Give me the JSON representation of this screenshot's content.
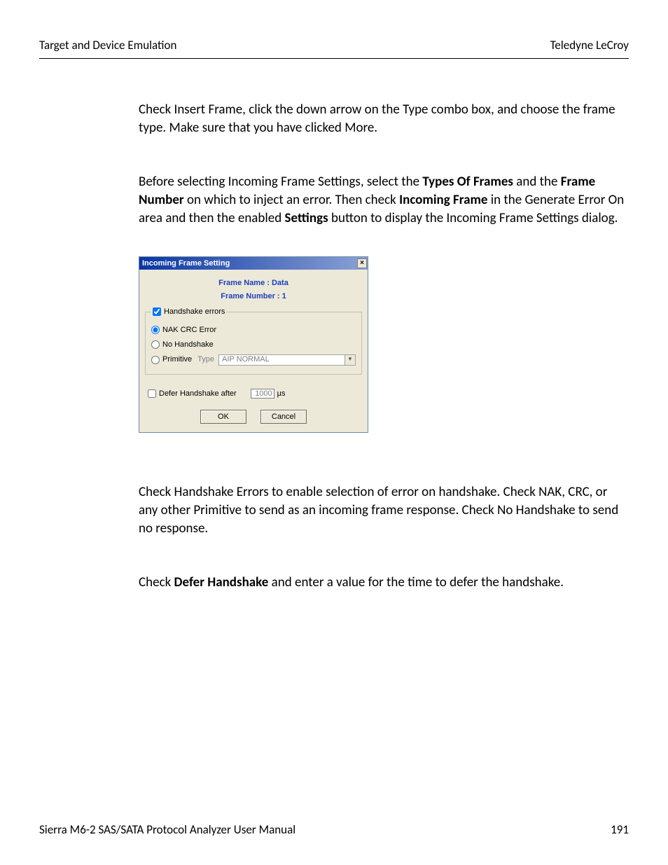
{
  "header": {
    "left": "Target and Device Emulation",
    "right": "Teledyne LeCroy"
  },
  "para1": "Check Insert Frame, click the down arrow on the Type combo box, and choose the frame type. Make sure that you have clicked More.",
  "para2_parts": {
    "a": "Before selecting Incoming Frame Settings, select the ",
    "b_bold": "Types Of Frames",
    "c": " and the ",
    "d_bold": "Frame Number",
    "e": " on which to inject an error. Then check ",
    "f_bold": "Incoming Frame",
    "g": " in the Generate Error On area and then the enabled ",
    "h_bold": "Settings",
    "i": " button to display the Incoming Frame Settings dialog."
  },
  "dialog": {
    "title": "Incoming Frame Setting",
    "frame_name_label": "Frame Name : Data",
    "frame_number_label": "Frame Number : 1",
    "handshake_legend": "Handshake errors",
    "nak_label": "NAK CRC Error",
    "nohandshake_label": "No Handshake",
    "primitive_label": "Primitive",
    "type_label": "Type",
    "dropdown_text": "AIP NORMAL",
    "defer_label": "Defer Handshake after",
    "defer_value": "1000",
    "defer_unit": "µs",
    "ok_label": "OK",
    "cancel_label": "Cancel"
  },
  "para3": "Check Handshake Errors to enable selection of error on handshake. Check NAK, CRC, or any other Primitive to send as an incoming frame response. Check No Handshake to send no response.",
  "para4_parts": {
    "a": "Check ",
    "b_bold": "Defer Handshake",
    "c": " and enter a value for the time to defer the handshake."
  },
  "footer": {
    "left": "Sierra M6-2 SAS/SATA Protocol Analyzer User Manual",
    "right": "191"
  }
}
